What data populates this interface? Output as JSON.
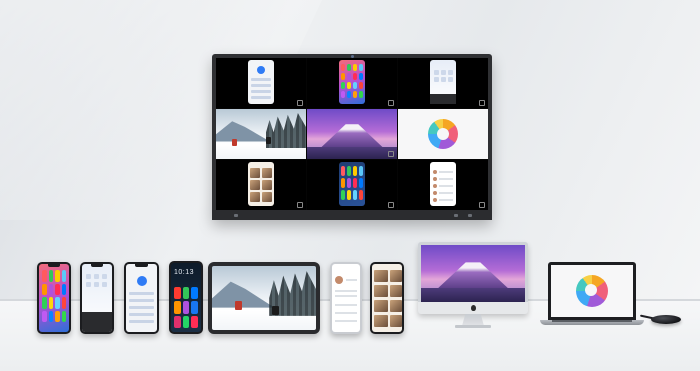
{
  "scene": {
    "description_colors": {
      "wall": "#e6e9ec",
      "floor": "#f1f2f4",
      "tv_frame": "#2f3033"
    }
  },
  "tv": {
    "grid": [
      {
        "screen": "phone-home-screen",
        "icon": "phone-icon"
      },
      {
        "screen": "phone-home-screen",
        "icon": "phone-icon"
      },
      {
        "screen": "phone-settings-screen",
        "icon": "phone-icon"
      },
      {
        "screen": "ski-photo",
        "icon": "image-icon"
      },
      {
        "screen": "mountain-photo",
        "icon": "image-icon"
      },
      {
        "screen": "donut-chart",
        "icon": "chart-icon"
      },
      {
        "screen": "photo-gallery",
        "icon": "phone-icon"
      },
      {
        "screen": "phone-home-screen",
        "icon": "phone-icon"
      },
      {
        "screen": "contacts-list",
        "icon": "phone-icon"
      }
    ]
  },
  "android_phone": {
    "time": "10:13"
  },
  "devices": [
    {
      "name": "iphone",
      "screen": "home-screen"
    },
    {
      "name": "iphone-lock",
      "screen": "control-center"
    },
    {
      "name": "iphone-settings",
      "screen": "settings"
    },
    {
      "name": "android-phone",
      "screen": "home-screen"
    },
    {
      "name": "tablet",
      "screen": "ski-photo"
    },
    {
      "name": "phone-contacts",
      "screen": "contacts"
    },
    {
      "name": "phone-gallery",
      "screen": "gallery"
    },
    {
      "name": "imac",
      "screen": "mountain-photo"
    },
    {
      "name": "laptop",
      "screen": "donut-chart"
    },
    {
      "name": "wireless-dongle",
      "screen": ""
    }
  ]
}
